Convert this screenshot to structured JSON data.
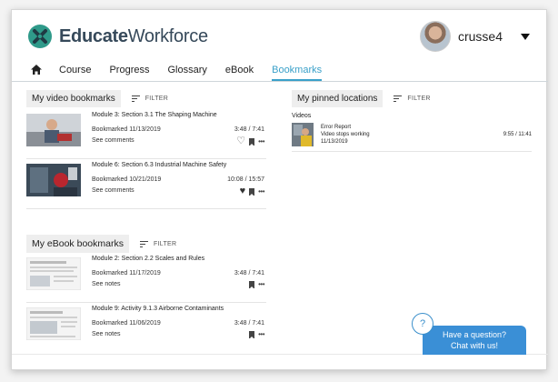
{
  "brand": {
    "name_bold": "Educate",
    "name_regular": "Workforce",
    "color": "#2f9a8a"
  },
  "user": {
    "username": "crusse4"
  },
  "nav": {
    "tabs": [
      {
        "label": "Course"
      },
      {
        "label": "Progress"
      },
      {
        "label": "Glossary"
      },
      {
        "label": "eBook"
      },
      {
        "label": "Bookmarks",
        "active": true
      }
    ],
    "accent": "#3aa0c9"
  },
  "video_bookmarks": {
    "title": "My video bookmarks",
    "filter": "FILTER",
    "items": [
      {
        "title": "Module 3: Section 3.1 The Shaping Machine",
        "bookmarked": "Bookmarked 11/13/2019",
        "time": "3:48 / 7:41",
        "link": "See comments",
        "liked": false
      },
      {
        "title": "Module 6: Section 6.3 Industrial Machine Safety",
        "bookmarked": "Bookmarked 10/21/2019",
        "time": "10:08 / 15:57",
        "link": "See comments",
        "liked": true
      }
    ]
  },
  "ebook_bookmarks": {
    "title": "My eBook bookmarks",
    "filter": "FILTER",
    "items": [
      {
        "title": "Module 2: Section 2.2 Scales and Rules",
        "bookmarked": "Bookmarked 11/17/2019",
        "time": "3:48 / 7:41",
        "link": "See notes"
      },
      {
        "title": "Module 9: Activity 9.1.3 Airborne Contaminants",
        "bookmarked": "Bookmarked 11/06/2019",
        "time": "3:48 / 7:41",
        "link": "See notes"
      }
    ]
  },
  "pinned": {
    "title": "My pinned locations",
    "filter": "FILTER",
    "subheading": "Videos",
    "items": [
      {
        "line1": "Error Report",
        "line2": "Video stops working",
        "line3": "11/13/2019",
        "time": "9:55 / 11:41"
      }
    ]
  },
  "help": {
    "icon": "?",
    "chat_line1": "Have a question?",
    "chat_line2": "Chat with us!",
    "color": "#3a8fd6"
  }
}
